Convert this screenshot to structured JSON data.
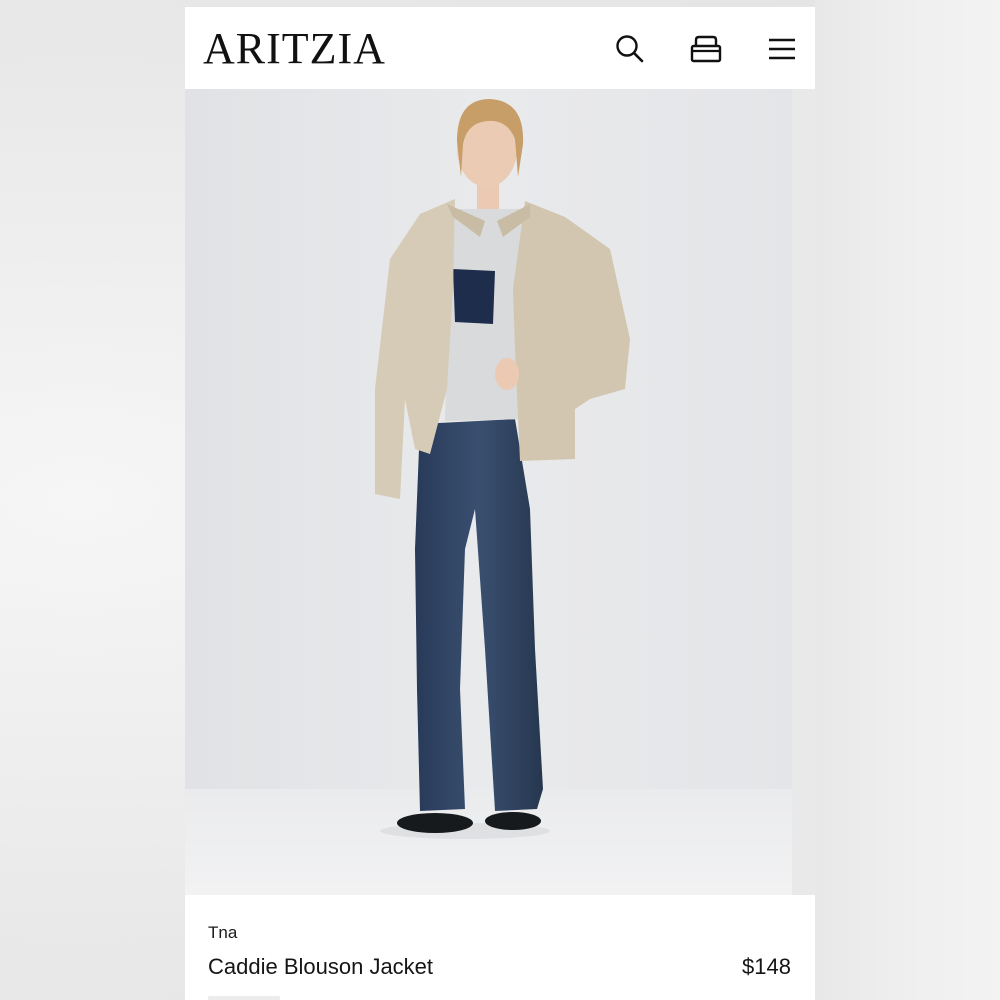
{
  "header": {
    "logo": "ARITZIA",
    "icons": [
      "search-icon",
      "shopping-bag-icon",
      "menu-icon"
    ]
  },
  "gallery": {
    "image_subject": "model-wearing-jacket-icon"
  },
  "product": {
    "brand": "Tna",
    "name": "Caddie Blouson Jacket",
    "price": "$148"
  },
  "colors": {
    "background": "#ffffff",
    "text": "#111111",
    "photo_backdrop": "#e8e9eb"
  }
}
